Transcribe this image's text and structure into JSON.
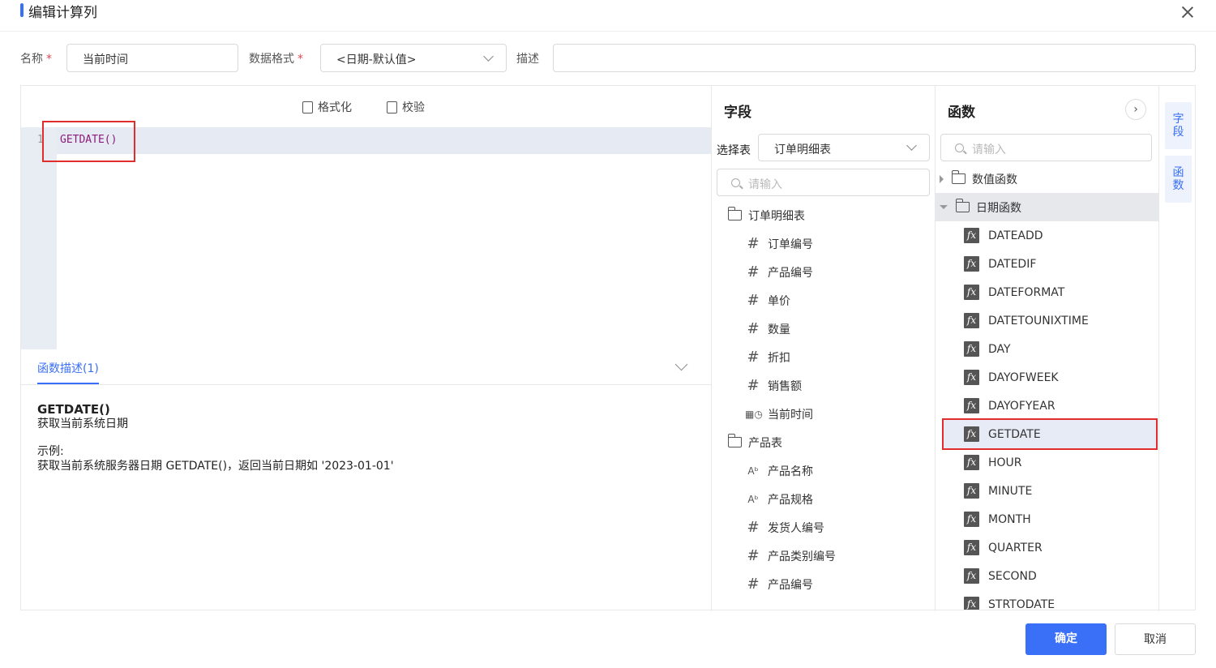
{
  "dialog": {
    "title": "编辑计算列",
    "ok_label": "确定",
    "cancel_label": "取消"
  },
  "form": {
    "name_label": "名称",
    "required_mark": "*",
    "name_value": "当前时间",
    "format_label": "数据格式",
    "format_value": "<日期-默认值>",
    "desc_label": "描述",
    "desc_value": ""
  },
  "editor": {
    "format_label": "格式化",
    "validate_label": "校验",
    "line_number": "1",
    "code": "GETDATE()"
  },
  "description": {
    "tab_label": "函数描述(1)",
    "func_name": "GETDATE()",
    "func_desc": "获取当前系统日期",
    "example_label": "示例:",
    "example_text": "获取当前系统服务器日期 GETDATE()，返回当前日期如 '2023-01-01'"
  },
  "fields": {
    "title": "字段",
    "select_label": "选择表",
    "select_value": "订单明细表",
    "search_placeholder": "请输入",
    "items": [
      {
        "type": "folder",
        "label": "订单明细表"
      },
      {
        "type": "number",
        "label": "订单编号"
      },
      {
        "type": "number",
        "label": "产品编号"
      },
      {
        "type": "number",
        "label": "单价"
      },
      {
        "type": "number",
        "label": "数量"
      },
      {
        "type": "number",
        "label": "折扣"
      },
      {
        "type": "number",
        "label": "销售额"
      },
      {
        "type": "date",
        "label": "当前时间"
      },
      {
        "type": "folder",
        "label": "产品表"
      },
      {
        "type": "text",
        "label": "产品名称"
      },
      {
        "type": "text",
        "label": "产品规格"
      },
      {
        "type": "number",
        "label": "发货人编号"
      },
      {
        "type": "number",
        "label": "产品类别编号"
      },
      {
        "type": "number",
        "label": "产品编号"
      }
    ]
  },
  "functions": {
    "title": "函数",
    "more_label": "›",
    "search_placeholder": "请输入",
    "groups": [
      {
        "label": "数值函数",
        "expanded": false
      },
      {
        "label": "日期函数",
        "expanded": true
      }
    ],
    "items": [
      "DATEADD",
      "DATEDIF",
      "DATEFORMAT",
      "DATETOUNIXTIME",
      "DAY",
      "DAYOFWEEK",
      "DAYOFYEAR",
      "GETDATE",
      "HOUR",
      "MINUTE",
      "MONTH",
      "QUARTER",
      "SECOND",
      "STRTODATE"
    ],
    "selected": "GETDATE",
    "fx_glyph": "fx"
  },
  "side_tabs": {
    "fields_label": "字\n段",
    "functions_label": "函\n数"
  },
  "colors": {
    "accent": "#3a6ff8",
    "highlight": "#e22d2d",
    "code": "#8b1a7a"
  }
}
